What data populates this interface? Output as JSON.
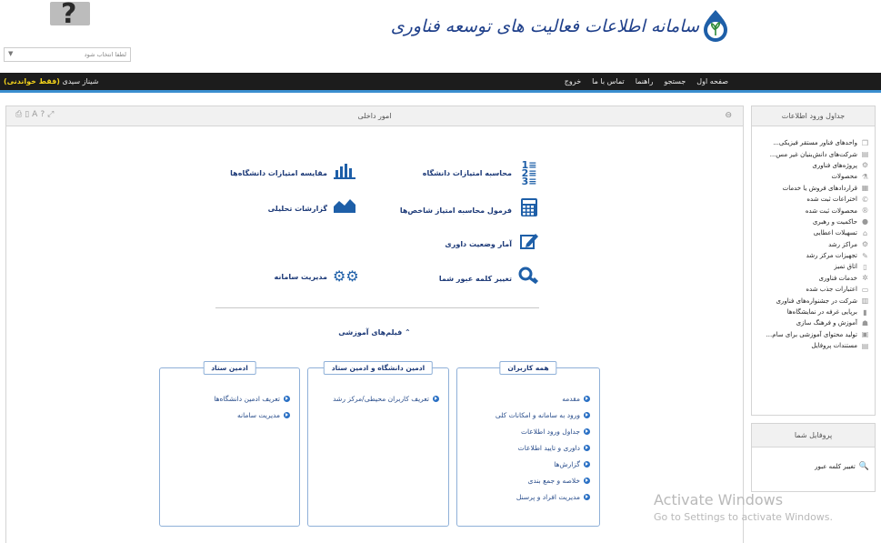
{
  "header": {
    "site_title": "سامانه اطلاعات فعالیت های توسعه فناوری",
    "select_placeholder": "لطفا انتخاب شود"
  },
  "topbar": {
    "nav": [
      "صفحه اول",
      "جستجو",
      "راهنما",
      "تماس با ما",
      "خروج"
    ],
    "user_name": "شیناز سیدی",
    "user_role": "(فقط خواندنی)"
  },
  "sidebar": {
    "title": "جداول ورود اطلاعات",
    "items": [
      {
        "label": "واحدهای فناور مستقر فیزیکی...",
        "icon": "cube-icon"
      },
      {
        "label": "شرکت‌های دانش‌بنیان غیر مس...",
        "icon": "document-icon"
      },
      {
        "label": "پروژه‌های فناوری",
        "icon": "gear-icon"
      },
      {
        "label": "محصولات",
        "icon": "flask-icon"
      },
      {
        "label": "قراردادهای فروش یا خدمات",
        "icon": "contract-icon"
      },
      {
        "label": "اختراعات ثبت شده",
        "icon": "copyright-icon"
      },
      {
        "label": "محصولات ثبت شده",
        "icon": "registered-icon"
      },
      {
        "label": "حاکمیت و رهبری",
        "icon": "circle-icon"
      },
      {
        "label": "تسهیلات اعطایی",
        "icon": "bank-icon"
      },
      {
        "label": "مراکز رشد",
        "icon": "cogs-icon"
      },
      {
        "label": "تجهیزات مرکز رشد",
        "icon": "wrench-icon"
      },
      {
        "label": "اتاق تمیز",
        "icon": "door-icon"
      },
      {
        "label": "خدمات فناوری",
        "icon": "cog-icon"
      },
      {
        "label": "اعتبارات جذب شده",
        "icon": "money-icon"
      },
      {
        "label": "شرکت در جشنواره‌های فناوری",
        "icon": "map-icon"
      },
      {
        "label": "برپایی غرفه در نمایشگاه‌ها",
        "icon": "book-icon"
      },
      {
        "label": "آموزش و فرهنگ سازی",
        "icon": "users-icon"
      },
      {
        "label": "تولید محتوای آموزشی برای سام...",
        "icon": "film-icon"
      },
      {
        "label": "مستندات پروفایل",
        "icon": "id-card-icon"
      }
    ]
  },
  "profile": {
    "title": "پروفایل شما",
    "change_password": "تغییر کلمه عبور"
  },
  "main": {
    "title": "امور داخلی",
    "items": {
      "calc_scores": "محاسبه امتیازات دانشگاه",
      "compare_scores": "مقایسه امتیازات دانشگاه‌ها",
      "formula": "فرمول محاسبه امتیاز شاخص‌ها",
      "reports": "گزارشات تحلیلی",
      "review_stats": "آمار وضعیت داوری",
      "change_password": "تغییر کلمه عبور شما",
      "system_admin": "مدیریت سامانه"
    },
    "videos_title": "فیلم‌های آموزشی",
    "groups": {
      "all_users": {
        "title": "همه کاربران",
        "links": [
          "مقدمه",
          "ورود به سامانه و امکانات کلی",
          "جداول ورود اطلاعات",
          "داوری و تایید اطلاعات",
          "گزارش‌ها",
          "خلاصه و جمع بندی",
          "مدیریت افراد و پرسنل"
        ]
      },
      "uni_admin": {
        "title": "ادمین دانشگاه و ادمین ستاد",
        "links": [
          "تعریف کاربران محیطی/مرکز رشد"
        ]
      },
      "hq_admin": {
        "title": "ادمین ستاد",
        "links": [
          "تعریف ادمین دانشگاه‌ها",
          "مدیریت سامانه"
        ]
      }
    }
  },
  "watermark": {
    "line1": "Activate Windows",
    "line2": "Go to Settings to activate Windows."
  },
  "colors": {
    "accent": "#1e5fa8",
    "topbar": "#1c1c1c",
    "role": "#f2d21b"
  }
}
